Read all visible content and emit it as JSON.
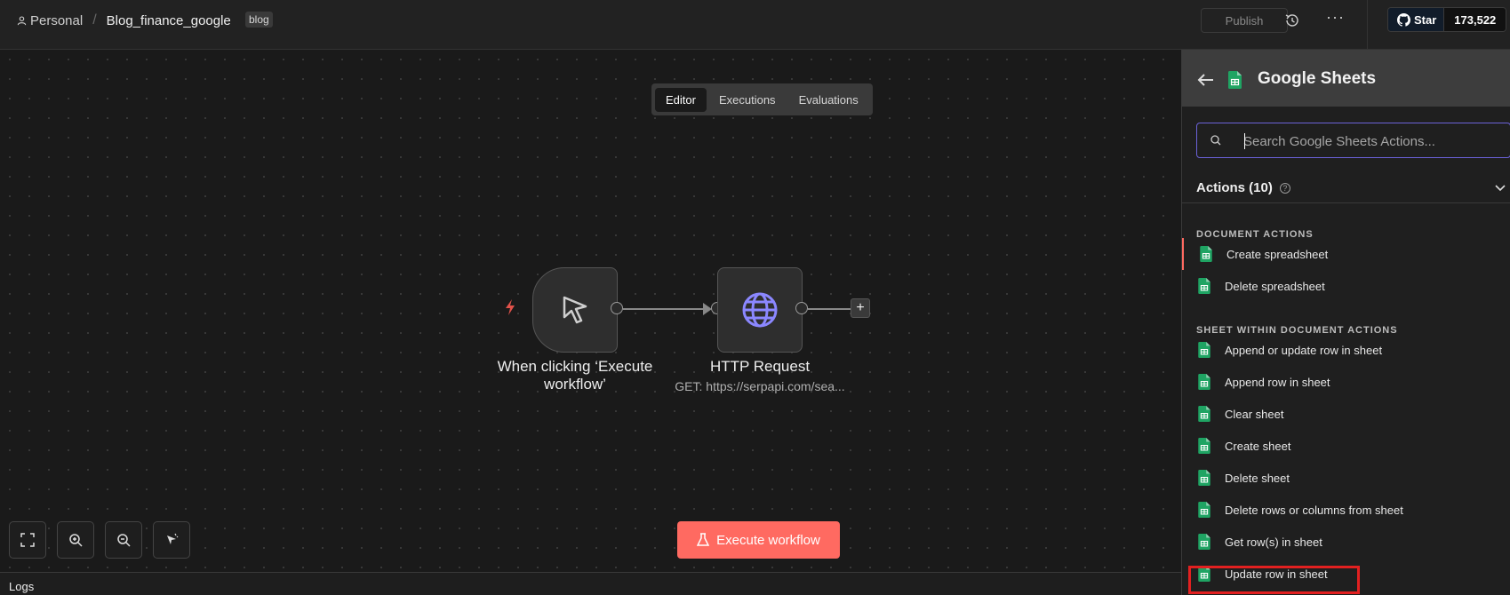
{
  "header": {
    "project": "Personal",
    "separator": "/",
    "workflow_name": "Blog_finance_google",
    "tag": "blog",
    "publish_label": "Publish",
    "github_star_label": "Star",
    "github_star_count": "173,522"
  },
  "tabs": [
    {
      "label": "Editor",
      "active": true
    },
    {
      "label": "Executions",
      "active": false
    },
    {
      "label": "Evaluations",
      "active": false
    }
  ],
  "nodes": {
    "trigger": {
      "title": "When clicking ‘Execute workflow’",
      "icon": "cursor-icon"
    },
    "http": {
      "title": "HTTP Request",
      "subtitle": "GET: https://serpapi.com/sea...",
      "icon": "globe-icon"
    }
  },
  "execute_label": "Execute workflow",
  "logs_label": "Logs",
  "panel": {
    "title": "Google Sheets",
    "search_placeholder": "Search Google Sheets Actions...",
    "actions_header": "Actions (10)",
    "sections": [
      {
        "title": "DOCUMENT ACTIONS",
        "items": [
          "Create spreadsheet",
          "Delete spreadsheet"
        ]
      },
      {
        "title": "SHEET WITHIN DOCUMENT ACTIONS",
        "items": [
          "Append or update row in sheet",
          "Append row in sheet",
          "Clear sheet",
          "Create sheet",
          "Delete sheet",
          "Delete rows or columns from sheet",
          "Get row(s) in sheet",
          "Update row in sheet"
        ]
      }
    ]
  },
  "colors": {
    "accent": "#ff6a61",
    "search_border": "#6b62d9",
    "sheets_green": "#1fa463",
    "globe_purple": "#8b87ff",
    "highlight": "#e22020"
  }
}
